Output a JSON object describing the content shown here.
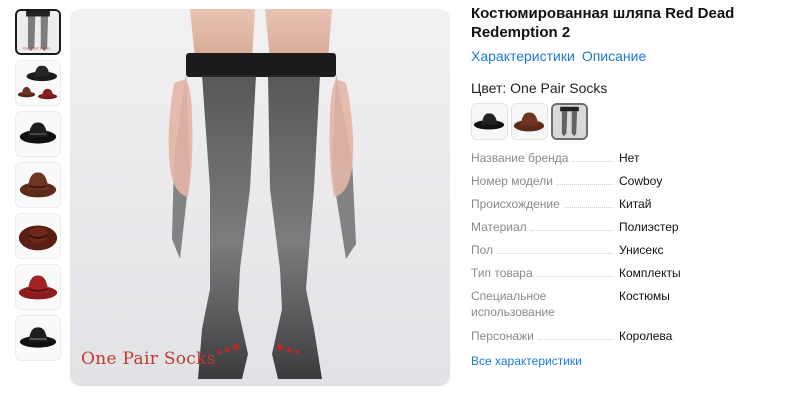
{
  "product": {
    "title": "Костюмированная шляпа Red Dead Redemption 2"
  },
  "tabs": [
    {
      "label": "Характеристики"
    },
    {
      "label": "Описание"
    }
  ],
  "image": {
    "caption": "One Pair Socks"
  },
  "color": {
    "label": "Цвет: One Pair Socks"
  },
  "thumbnails": [
    {
      "icon": "socks-thumbnail",
      "active": true
    },
    {
      "icon": "hats-set-thumbnail"
    },
    {
      "icon": "black-hat-thumbnail"
    },
    {
      "icon": "brown-hat-thumbnail"
    },
    {
      "icon": "dark-red-hat-thumbnail"
    },
    {
      "icon": "red-hat-thumbnail"
    },
    {
      "icon": "black-hat-thumbnail"
    }
  ],
  "swatches": [
    {
      "icon": "black-hat-swatch"
    },
    {
      "icon": "brown-hat-swatch"
    },
    {
      "icon": "socks-swatch",
      "selected": true
    }
  ],
  "specs": [
    {
      "name": "Название бренда",
      "value": "Нет"
    },
    {
      "name": "Номер модели",
      "value": "Cowboy"
    },
    {
      "name": "Происхождение",
      "value": "Китай"
    },
    {
      "name": "Материал",
      "value": "Полиэстер"
    },
    {
      "name": "Пол",
      "value": "Унисекс"
    },
    {
      "name": "Тип товара",
      "value": "Комплекты"
    },
    {
      "name": "Специальное использование",
      "value": "Костюмы"
    },
    {
      "name": "Персонажи",
      "value": "Королева"
    }
  ],
  "all_specs_label": "Все характеристики",
  "colors": {
    "link": "#1e7ad6",
    "caption": "#c0392b"
  }
}
